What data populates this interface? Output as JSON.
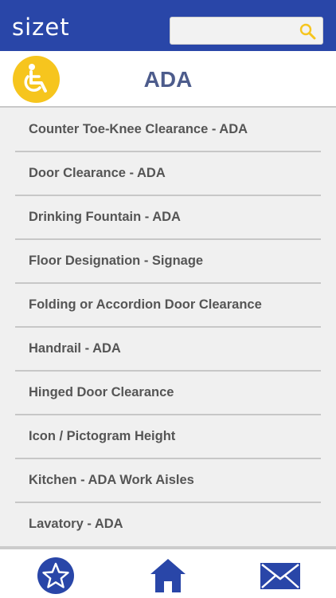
{
  "app": {
    "logo": "sizet"
  },
  "search": {
    "placeholder": "",
    "value": ""
  },
  "header": {
    "title": "ADA",
    "category_icon": "wheelchair-icon"
  },
  "list": {
    "items": [
      "Counter Toe-Knee Clearance - ADA",
      "Door Clearance - ADA",
      "Drinking Fountain - ADA",
      "Floor Designation - Signage",
      "Folding or Accordion Door Clearance",
      "Handrail - ADA",
      "Hinged Door Clearance",
      "Icon / Pictogram Height",
      "Kitchen - ADA Work Aisles",
      "Lavatory - ADA"
    ]
  },
  "tabbar": {
    "icons": [
      "star-icon",
      "home-icon",
      "mail-icon"
    ]
  },
  "colors": {
    "brand_blue": "#2946a8",
    "accent_yellow": "#f6c51e",
    "title_blue": "#4d5c8c",
    "list_text": "#555555"
  }
}
